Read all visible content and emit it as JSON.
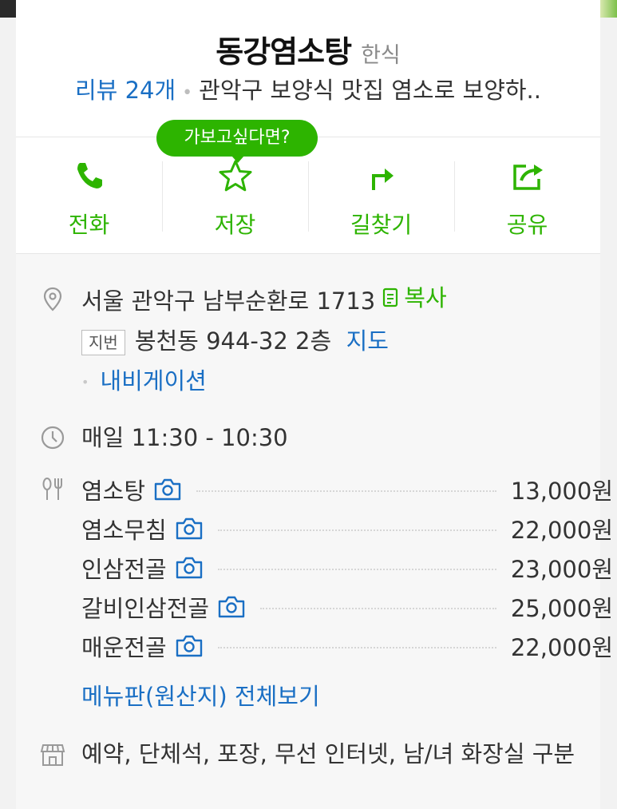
{
  "place": {
    "name": "동강염소탕",
    "category": "한식",
    "review_label": "리뷰 24개",
    "separator": "•",
    "description": "관악구 보양식 맛집 염소로 보양하.."
  },
  "tooltip": "가보고싶다면?",
  "actions": [
    {
      "label": "전화",
      "icon": "phone-icon"
    },
    {
      "label": "저장",
      "icon": "star-icon"
    },
    {
      "label": "길찾기",
      "icon": "directions-icon"
    },
    {
      "label": "공유",
      "icon": "share-icon"
    }
  ],
  "address": {
    "road": "서울 관악구 남부순환로 1713",
    "copy_label": "복사",
    "jibun_badge": "지번",
    "jibun": "봉천동 944-32 2층",
    "map_link": "지도",
    "bullet": "•",
    "navigation_link": "내비게이션"
  },
  "hours": "매일 11:30 - 10:30",
  "menu": [
    {
      "name": "염소탕",
      "price": "13,000원"
    },
    {
      "name": "염소무침",
      "price": "22,000원"
    },
    {
      "name": "인삼전골",
      "price": "23,000원"
    },
    {
      "name": "갈비인삼전골",
      "price": "25,000원"
    },
    {
      "name": "매운전골",
      "price": "22,000원"
    }
  ],
  "menu_link": "메뉴판(원산지) 전체보기",
  "facilities": "예약, 단체석, 포장, 무선 인터넷, 남/녀 화장실 구분",
  "colors": {
    "accent_green": "#2db400",
    "link_blue": "#1a6fc4"
  }
}
